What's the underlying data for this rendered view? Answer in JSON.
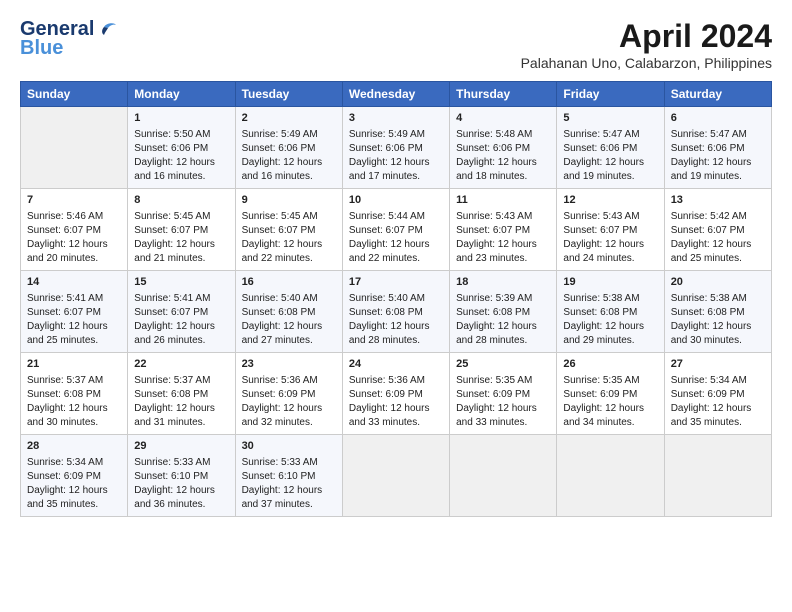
{
  "logo": {
    "line1": "General",
    "line2": "Blue"
  },
  "title": "April 2024",
  "subtitle": "Palahanan Uno, Calabarzon, Philippines",
  "days_of_week": [
    "Sunday",
    "Monday",
    "Tuesday",
    "Wednesday",
    "Thursday",
    "Friday",
    "Saturday"
  ],
  "weeks": [
    [
      {
        "day": "",
        "content": ""
      },
      {
        "day": "1",
        "content": "Sunrise: 5:50 AM\nSunset: 6:06 PM\nDaylight: 12 hours\nand 16 minutes."
      },
      {
        "day": "2",
        "content": "Sunrise: 5:49 AM\nSunset: 6:06 PM\nDaylight: 12 hours\nand 16 minutes."
      },
      {
        "day": "3",
        "content": "Sunrise: 5:49 AM\nSunset: 6:06 PM\nDaylight: 12 hours\nand 17 minutes."
      },
      {
        "day": "4",
        "content": "Sunrise: 5:48 AM\nSunset: 6:06 PM\nDaylight: 12 hours\nand 18 minutes."
      },
      {
        "day": "5",
        "content": "Sunrise: 5:47 AM\nSunset: 6:06 PM\nDaylight: 12 hours\nand 19 minutes."
      },
      {
        "day": "6",
        "content": "Sunrise: 5:47 AM\nSunset: 6:06 PM\nDaylight: 12 hours\nand 19 minutes."
      }
    ],
    [
      {
        "day": "7",
        "content": "Sunrise: 5:46 AM\nSunset: 6:07 PM\nDaylight: 12 hours\nand 20 minutes."
      },
      {
        "day": "8",
        "content": "Sunrise: 5:45 AM\nSunset: 6:07 PM\nDaylight: 12 hours\nand 21 minutes."
      },
      {
        "day": "9",
        "content": "Sunrise: 5:45 AM\nSunset: 6:07 PM\nDaylight: 12 hours\nand 22 minutes."
      },
      {
        "day": "10",
        "content": "Sunrise: 5:44 AM\nSunset: 6:07 PM\nDaylight: 12 hours\nand 22 minutes."
      },
      {
        "day": "11",
        "content": "Sunrise: 5:43 AM\nSunset: 6:07 PM\nDaylight: 12 hours\nand 23 minutes."
      },
      {
        "day": "12",
        "content": "Sunrise: 5:43 AM\nSunset: 6:07 PM\nDaylight: 12 hours\nand 24 minutes."
      },
      {
        "day": "13",
        "content": "Sunrise: 5:42 AM\nSunset: 6:07 PM\nDaylight: 12 hours\nand 25 minutes."
      }
    ],
    [
      {
        "day": "14",
        "content": "Sunrise: 5:41 AM\nSunset: 6:07 PM\nDaylight: 12 hours\nand 25 minutes."
      },
      {
        "day": "15",
        "content": "Sunrise: 5:41 AM\nSunset: 6:07 PM\nDaylight: 12 hours\nand 26 minutes."
      },
      {
        "day": "16",
        "content": "Sunrise: 5:40 AM\nSunset: 6:08 PM\nDaylight: 12 hours\nand 27 minutes."
      },
      {
        "day": "17",
        "content": "Sunrise: 5:40 AM\nSunset: 6:08 PM\nDaylight: 12 hours\nand 28 minutes."
      },
      {
        "day": "18",
        "content": "Sunrise: 5:39 AM\nSunset: 6:08 PM\nDaylight: 12 hours\nand 28 minutes."
      },
      {
        "day": "19",
        "content": "Sunrise: 5:38 AM\nSunset: 6:08 PM\nDaylight: 12 hours\nand 29 minutes."
      },
      {
        "day": "20",
        "content": "Sunrise: 5:38 AM\nSunset: 6:08 PM\nDaylight: 12 hours\nand 30 minutes."
      }
    ],
    [
      {
        "day": "21",
        "content": "Sunrise: 5:37 AM\nSunset: 6:08 PM\nDaylight: 12 hours\nand 30 minutes."
      },
      {
        "day": "22",
        "content": "Sunrise: 5:37 AM\nSunset: 6:08 PM\nDaylight: 12 hours\nand 31 minutes."
      },
      {
        "day": "23",
        "content": "Sunrise: 5:36 AM\nSunset: 6:09 PM\nDaylight: 12 hours\nand 32 minutes."
      },
      {
        "day": "24",
        "content": "Sunrise: 5:36 AM\nSunset: 6:09 PM\nDaylight: 12 hours\nand 33 minutes."
      },
      {
        "day": "25",
        "content": "Sunrise: 5:35 AM\nSunset: 6:09 PM\nDaylight: 12 hours\nand 33 minutes."
      },
      {
        "day": "26",
        "content": "Sunrise: 5:35 AM\nSunset: 6:09 PM\nDaylight: 12 hours\nand 34 minutes."
      },
      {
        "day": "27",
        "content": "Sunrise: 5:34 AM\nSunset: 6:09 PM\nDaylight: 12 hours\nand 35 minutes."
      }
    ],
    [
      {
        "day": "28",
        "content": "Sunrise: 5:34 AM\nSunset: 6:09 PM\nDaylight: 12 hours\nand 35 minutes."
      },
      {
        "day": "29",
        "content": "Sunrise: 5:33 AM\nSunset: 6:10 PM\nDaylight: 12 hours\nand 36 minutes."
      },
      {
        "day": "30",
        "content": "Sunrise: 5:33 AM\nSunset: 6:10 PM\nDaylight: 12 hours\nand 37 minutes."
      },
      {
        "day": "",
        "content": ""
      },
      {
        "day": "",
        "content": ""
      },
      {
        "day": "",
        "content": ""
      },
      {
        "day": "",
        "content": ""
      }
    ]
  ]
}
